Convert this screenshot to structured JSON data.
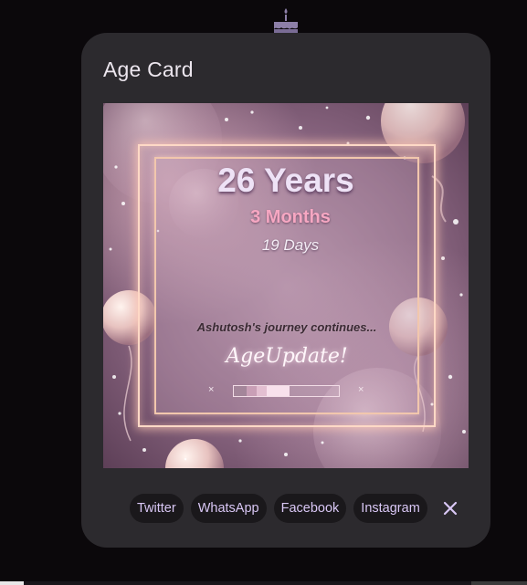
{
  "dialog": {
    "title": "Age Card"
  },
  "card": {
    "years": "26 Years",
    "months": "3 Months",
    "days": "19 Days",
    "tagline": "Ashutosh's journey continues...",
    "brand": "AgeUpdate!",
    "mark_left": "×",
    "mark_right": "×",
    "progress_fraction": 0.53
  },
  "share": {
    "buttons": [
      "Twitter",
      "WhatsApp",
      "Facebook",
      "Instagram"
    ],
    "close_icon": "close-icon",
    "close_label": "✕"
  },
  "colors": {
    "accent": "#d9c7f5",
    "surface": "#2c2a2e",
    "background": "#0b080b",
    "months_pink": "#f6a7c2"
  },
  "icons": {
    "top": "birthday-cake-icon"
  }
}
